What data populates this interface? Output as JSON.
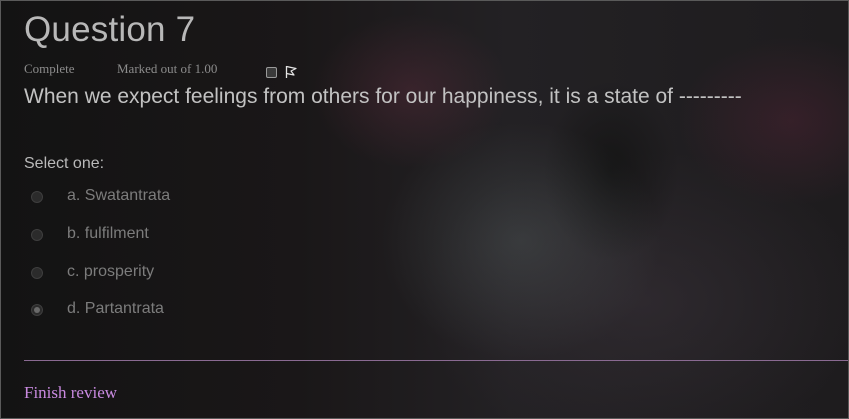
{
  "question": {
    "title": "Question 7",
    "state": "Complete",
    "grade": "Marked out of 1.00",
    "flag_icon": "flag-icon",
    "text": "When we expect feelings from others for our happiness, it is a state of ---------",
    "prompt": "Select one:",
    "options": [
      {
        "label": "a. Swatantrata",
        "selected": false
      },
      {
        "label": "b. fulfilment",
        "selected": false
      },
      {
        "label": "c. prosperity",
        "selected": false
      },
      {
        "label": "d. Partantrata",
        "selected": true
      }
    ]
  },
  "footer": {
    "finish_review": "Finish review"
  },
  "colors": {
    "link": "#c98ae0",
    "divider": "#8a6a92",
    "text": "#c2c2c2"
  }
}
